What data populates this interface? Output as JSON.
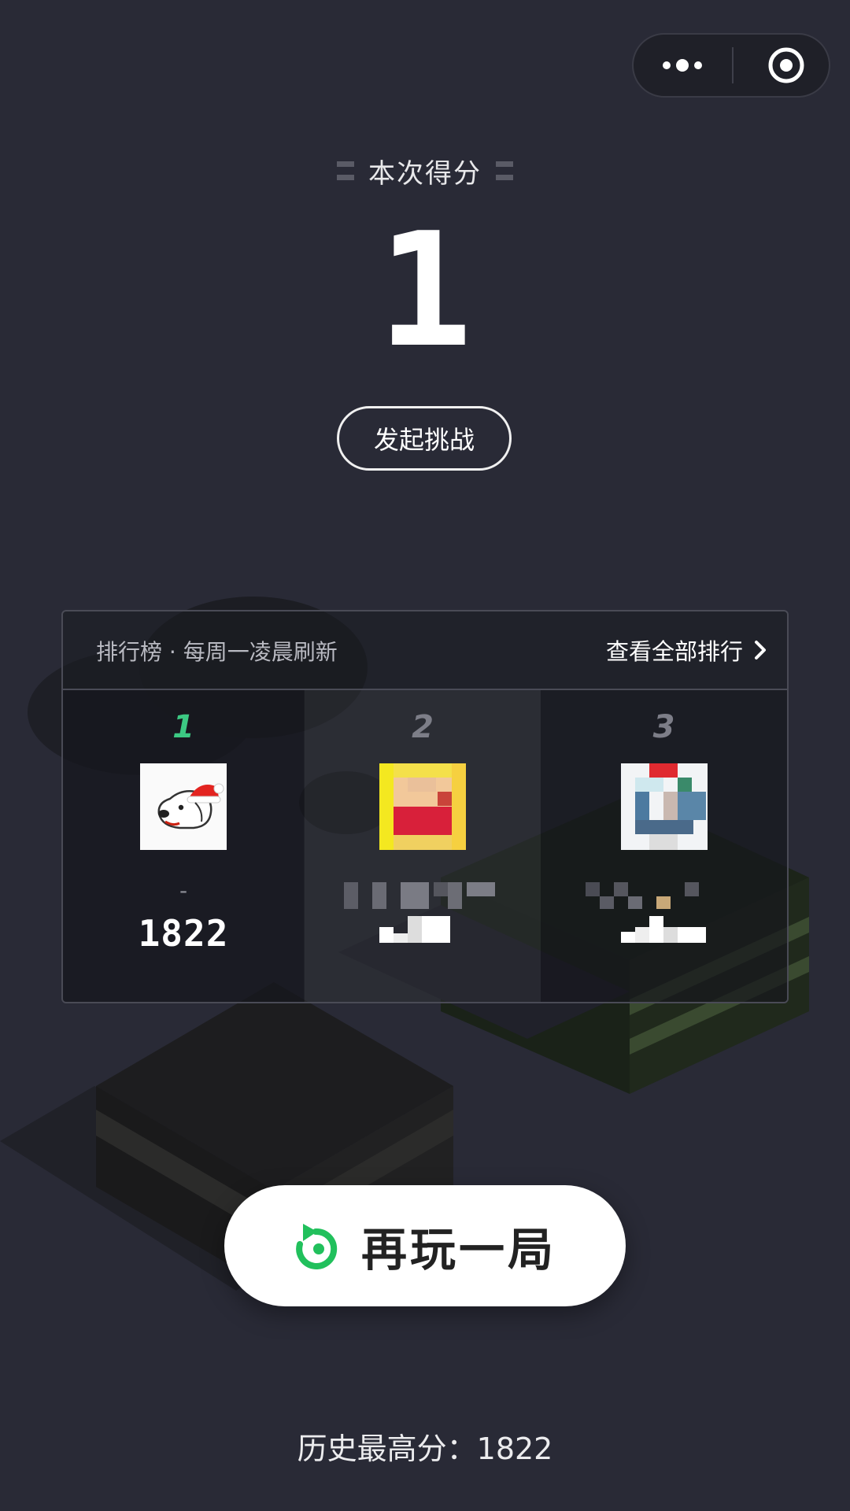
{
  "capsule": {
    "more_icon": "more-dots-icon",
    "close_icon": "target-close-icon"
  },
  "score": {
    "title": "本次得分",
    "value": "1"
  },
  "challenge_label": "发起挑战",
  "leaderboard": {
    "title": "排行榜 · 每周一凌晨刷新",
    "view_all_label": "查看全部排行",
    "rank_accent_color": "#3cc983",
    "rank_muted_color": "#7d7e88",
    "entries": [
      {
        "rank": "1",
        "name": "-",
        "score": "1822"
      },
      {
        "rank": "2"
      },
      {
        "rank": "3"
      }
    ]
  },
  "replay_label": "再玩一局",
  "replay_icon_color": "#21c05c",
  "history_best": "历史最高分：1822"
}
